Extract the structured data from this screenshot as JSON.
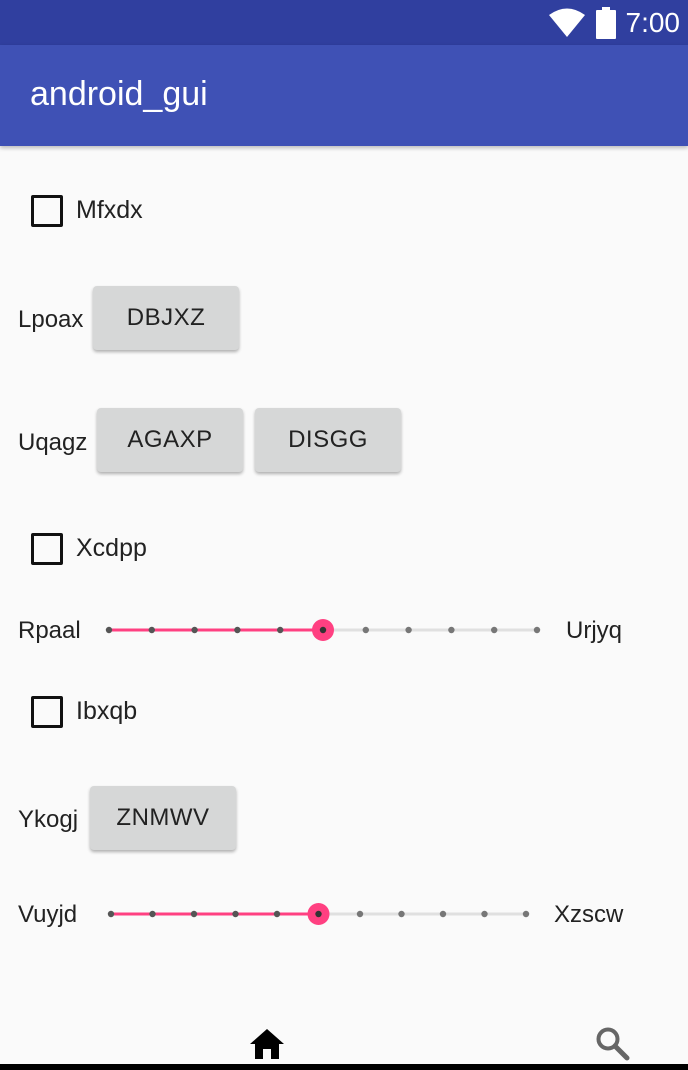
{
  "status_bar": {
    "time": "7:00",
    "wifi_icon": "wifi-icon",
    "battery_icon": "battery-icon"
  },
  "app_bar": {
    "title": "android_gui"
  },
  "content": {
    "checkbox1": {
      "label": "Mfxdx",
      "checked": false
    },
    "row_lpoax": {
      "label": "Lpoax",
      "button": "DBJXZ"
    },
    "row_uqagz": {
      "label": "Uqagz",
      "button1": "AGAXP",
      "button2": "DISGG"
    },
    "checkbox2": {
      "label": "Xcdpp",
      "checked": false
    },
    "slider1": {
      "left_label": "Rpaal",
      "right_label": "Urjyq",
      "steps": 10,
      "value": 5
    },
    "checkbox3": {
      "label": "Ibxqb",
      "checked": false
    },
    "row_ykogj": {
      "label": "Ykogj",
      "button": "ZNMWV"
    },
    "slider2": {
      "left_label": "Vuyjd",
      "right_label": "Xzscw",
      "steps": 10,
      "value": 5
    }
  },
  "bottom_nav": {
    "home_icon": "home-icon",
    "search_icon": "search-icon"
  },
  "colors": {
    "primary": "#3f51b5",
    "primary_dark": "#303f9f",
    "accent": "#ff4081"
  }
}
